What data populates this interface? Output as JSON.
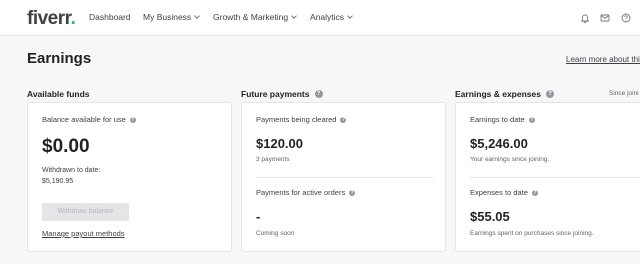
{
  "nav": {
    "logo_text": "fiverr",
    "logo_dot": ".",
    "items": [
      {
        "label": "Dashboard"
      },
      {
        "label": "My Business"
      },
      {
        "label": "Growth & Marketing"
      },
      {
        "label": "Analytics"
      }
    ],
    "icons": [
      "bell-icon",
      "mail-icon",
      "help-icon"
    ]
  },
  "page": {
    "title": "Earnings",
    "learn_more": "Learn more about this"
  },
  "available_funds": {
    "section_label": "Available funds",
    "balance_label": "Balance available for use",
    "balance_value": "$0.00",
    "withdrawn_label": "Withdrawn to date:",
    "withdrawn_value": "$5,190.95",
    "withdraw_button": "Withdraw balance",
    "manage_link": "Manage payout methods"
  },
  "future_payments": {
    "section_label": "Future payments",
    "cleared_label": "Payments being cleared",
    "cleared_value": "$120.00",
    "cleared_count": "3 payments",
    "active_label": "Payments for active orders",
    "active_value": "-",
    "active_note": "Coming soon"
  },
  "earnings_expenses": {
    "section_label": "Earnings & expenses",
    "since_label": "Since joini",
    "earnings_label": "Earnings to date",
    "earnings_value": "$5,246.00",
    "earnings_note": "Your earnings since joining.",
    "expenses_label": "Expenses to date",
    "expenses_value": "$55.05",
    "expenses_note": "Earnings spent on purchases since joining."
  },
  "colors": {
    "brand_green": "#1dbf73",
    "text_dark": "#222325",
    "border": "#e4e5e7"
  }
}
